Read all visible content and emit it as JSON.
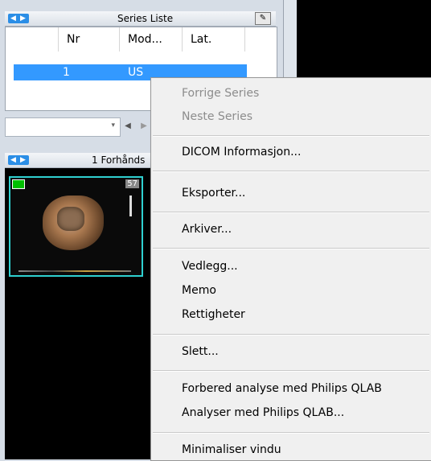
{
  "series_panel": {
    "title": "Series Liste",
    "nav_prev": "◀",
    "nav_next": "▶",
    "pin_icon": "pin-icon",
    "columns": [
      "",
      "Nr",
      "Mod...",
      "Lat."
    ],
    "rows": [
      {
        "nr": "1",
        "mod": "US",
        "lat": ""
      }
    ]
  },
  "navigator": {
    "combo_value": "",
    "combo_arrow": "▾",
    "prev": "◀",
    "next": "▶"
  },
  "preview_panel": {
    "title": "1 Forhånds",
    "nav_prev": "◀",
    "nav_next": "▶",
    "thumbnail_count": "57"
  },
  "context_menu": {
    "items": [
      {
        "label": "Forrige Series",
        "enabled": false
      },
      {
        "label": "Neste Series",
        "enabled": false
      },
      {
        "label": "DICOM Informasjon...",
        "enabled": true
      },
      {
        "label": "Eksporter...",
        "enabled": true
      },
      {
        "label": "Arkiver...",
        "enabled": true
      },
      {
        "label": "Vedlegg...",
        "enabled": true
      },
      {
        "label": "Memo",
        "enabled": true
      },
      {
        "label": "Rettigheter",
        "enabled": true
      },
      {
        "label": "Slett...",
        "enabled": true
      },
      {
        "label": "Forbered analyse med Philips QLAB",
        "enabled": true
      },
      {
        "label": "Analyser med Philips QLAB...",
        "enabled": true
      },
      {
        "label": "Minimaliser vindu",
        "enabled": true
      }
    ]
  },
  "colors": {
    "selection": "#3399ff",
    "thumbnail_border": "#2fd0d0",
    "menu_bg": "#f0f0f0",
    "disabled_text": "#8c8c8c"
  }
}
